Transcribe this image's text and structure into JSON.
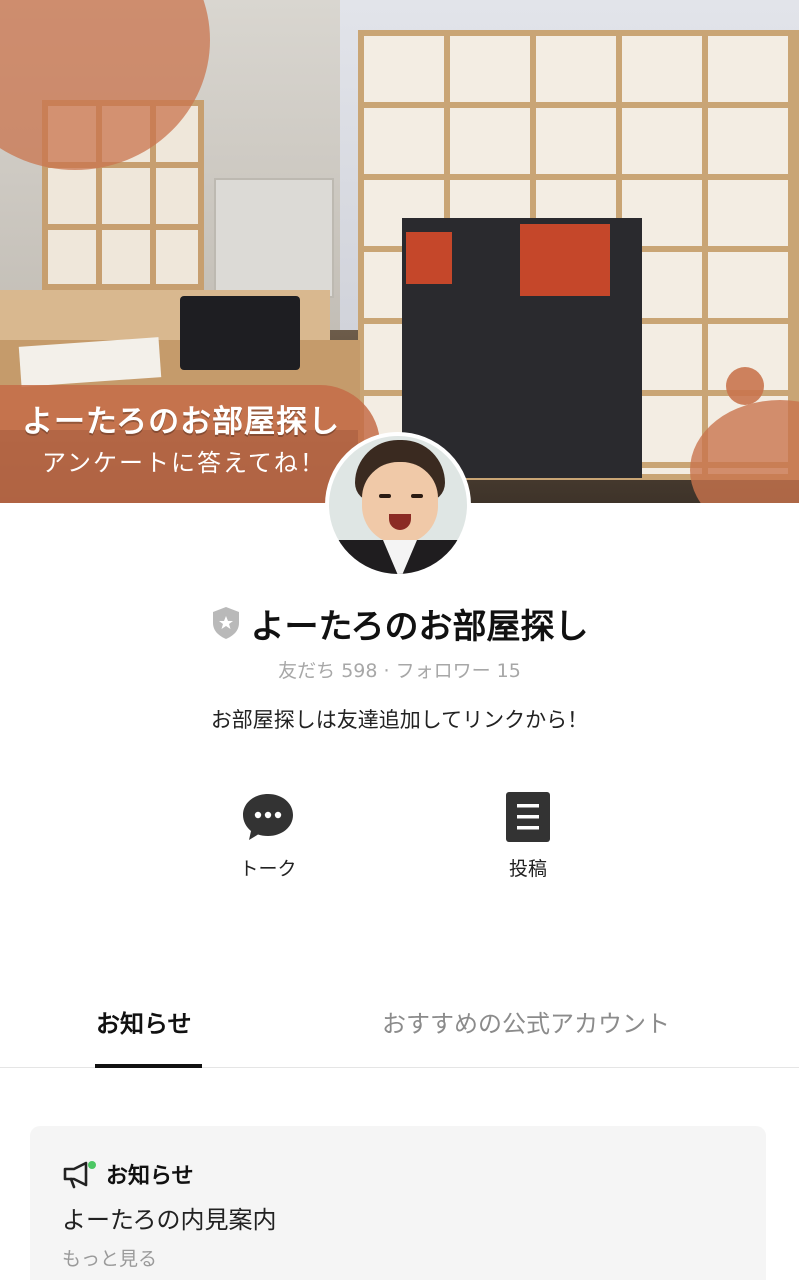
{
  "cover": {
    "title": "よーたろのお部屋探し",
    "subtitle": "アンケートに答えてね！"
  },
  "profile": {
    "account_name": "よーたろのお部屋探し",
    "badge_icon": "shield-star-icon",
    "stats": "友だち 598 · フォロワー 15",
    "description": "お部屋探しは友達追加してリンクから！"
  },
  "actions": {
    "talk": {
      "label": "トーク",
      "icon": "chat-bubble-icon"
    },
    "posts": {
      "label": "投稿",
      "icon": "post-list-icon"
    }
  },
  "tabs": [
    {
      "label": "お知らせ",
      "active": true
    },
    {
      "label": "おすすめの公式アカウント",
      "active": false
    }
  ],
  "notice": {
    "heading": "お知らせ",
    "icon": "megaphone-icon",
    "title": "よーたろの内見案内",
    "more": "もっと見る"
  },
  "colors": {
    "accent_green": "#4cc764",
    "icon_dark": "#333333",
    "cover_accent": "#c9744e"
  }
}
